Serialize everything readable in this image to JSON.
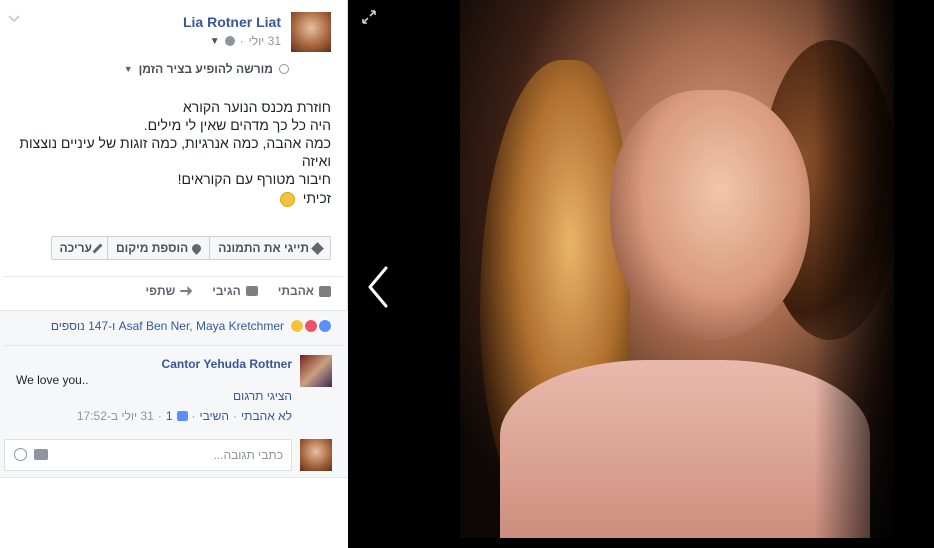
{
  "post": {
    "author": "Lia Rotner Liat",
    "date": "31 יולי",
    "timeline_label": "מורשה להופיע בציר הזמן",
    "text_lines": [
      "חוזרת מכנס הנוער הקורא",
      "היה כל כך מדהים שאין לי מילים.",
      "כמה אהבה, כמה אנרגיות, כמה זוגות של עיניים נוצצות ואיזה",
      "חיבור מטורף עם הקוראים!"
    ],
    "signature": "זכיתי"
  },
  "photo_buttons": {
    "tag": "תייגי את התמונה",
    "location": "הוספת מיקום",
    "edit": "עריכה"
  },
  "actions": {
    "like": "אהבתי",
    "comment": "הגיבי",
    "share": "שתפי"
  },
  "reactions": {
    "summary": "Asaf Ben Ner, Maya Kretchmer ו-147 נוספים"
  },
  "comment": {
    "author": "Cantor Yehuda Rottner",
    "body": "We love you..",
    "translate": "הציגי תרגום",
    "unlike": "לא אהבתי",
    "reply": "השיבי",
    "likes": "1",
    "time": "31 יולי ב-17:52"
  },
  "reply_box": {
    "placeholder": "כתבי תגובה..."
  },
  "colors": {
    "link": "#365899",
    "muted": "#90949c"
  }
}
